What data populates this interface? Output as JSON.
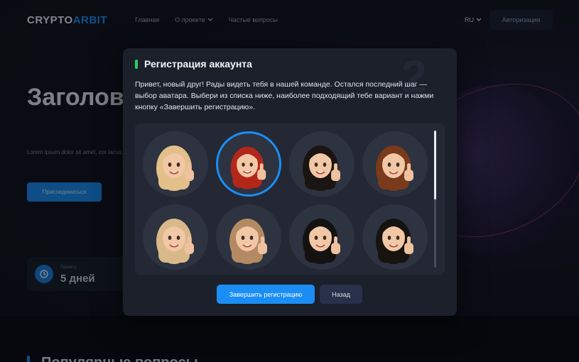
{
  "header": {
    "logo_main": "CRYPTO",
    "logo_accent": "ARBIT",
    "nav": [
      "Главная",
      "О проекте",
      "Частые вопросы"
    ],
    "lang": "RU",
    "auth_label": "Авторизация"
  },
  "hero": {
    "title": "Заголовок в две-тр",
    "text": "Lorem ipsum dolor sit amet, cor lacus, leo viverra sed tortor ege",
    "join_label": "Присоединиться"
  },
  "stat": {
    "label": "Проекту",
    "value": "5 дней"
  },
  "section": {
    "title": "Популярные вопросы"
  },
  "modal": {
    "step": "2",
    "title": "Регистрация аккаунта",
    "text": "Привет, новый друг! Рады видеть тебя в нашей команде. Остался последний шаг — выбор аватара. Выбери из списка ниже, наиболее подходящий тебе вариант и нажми кнопку «Завершить регистрацию».",
    "finish_label": "Завершить регистрацию",
    "back_label": "Назад",
    "scroll_fraction": 0.5,
    "avatars": [
      {
        "name": "avatar-blonde-long",
        "hair": "#e3c08a",
        "selected": false
      },
      {
        "name": "avatar-red-hair",
        "hair": "#b3271b",
        "selected": true
      },
      {
        "name": "avatar-black-long",
        "hair": "#1a1512",
        "selected": false
      },
      {
        "name": "avatar-curly-auburn",
        "hair": "#7a3a1c",
        "selected": false
      },
      {
        "name": "avatar-blonde-curly",
        "hair": "#d9b98a",
        "selected": false
      },
      {
        "name": "avatar-light-brown-bangs",
        "hair": "#b38a63",
        "selected": false
      },
      {
        "name": "avatar-black-bangs",
        "hair": "#141210",
        "selected": false
      },
      {
        "name": "avatar-black-straight",
        "hair": "#17130f",
        "selected": false
      }
    ],
    "accent_color": "#22d266",
    "selection_color": "#1a8ef5"
  }
}
